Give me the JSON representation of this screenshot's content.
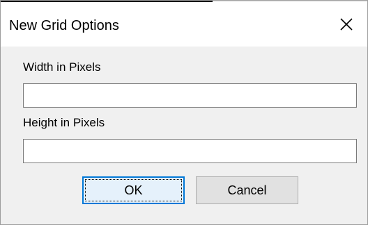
{
  "window": {
    "title": "New Grid Options",
    "close_icon": "close-icon"
  },
  "form": {
    "width_label": "Width in Pixels",
    "width_value": "",
    "height_label": "Height in Pixels",
    "height_value": ""
  },
  "buttons": {
    "ok_label": "OK",
    "cancel_label": "Cancel"
  },
  "colors": {
    "dialog_background": "#f0f0f0",
    "titlebar_background": "#ffffff",
    "default_button_border": "#0078d7",
    "default_button_fill": "#e5f1fb",
    "button_fill": "#e1e1e1"
  }
}
